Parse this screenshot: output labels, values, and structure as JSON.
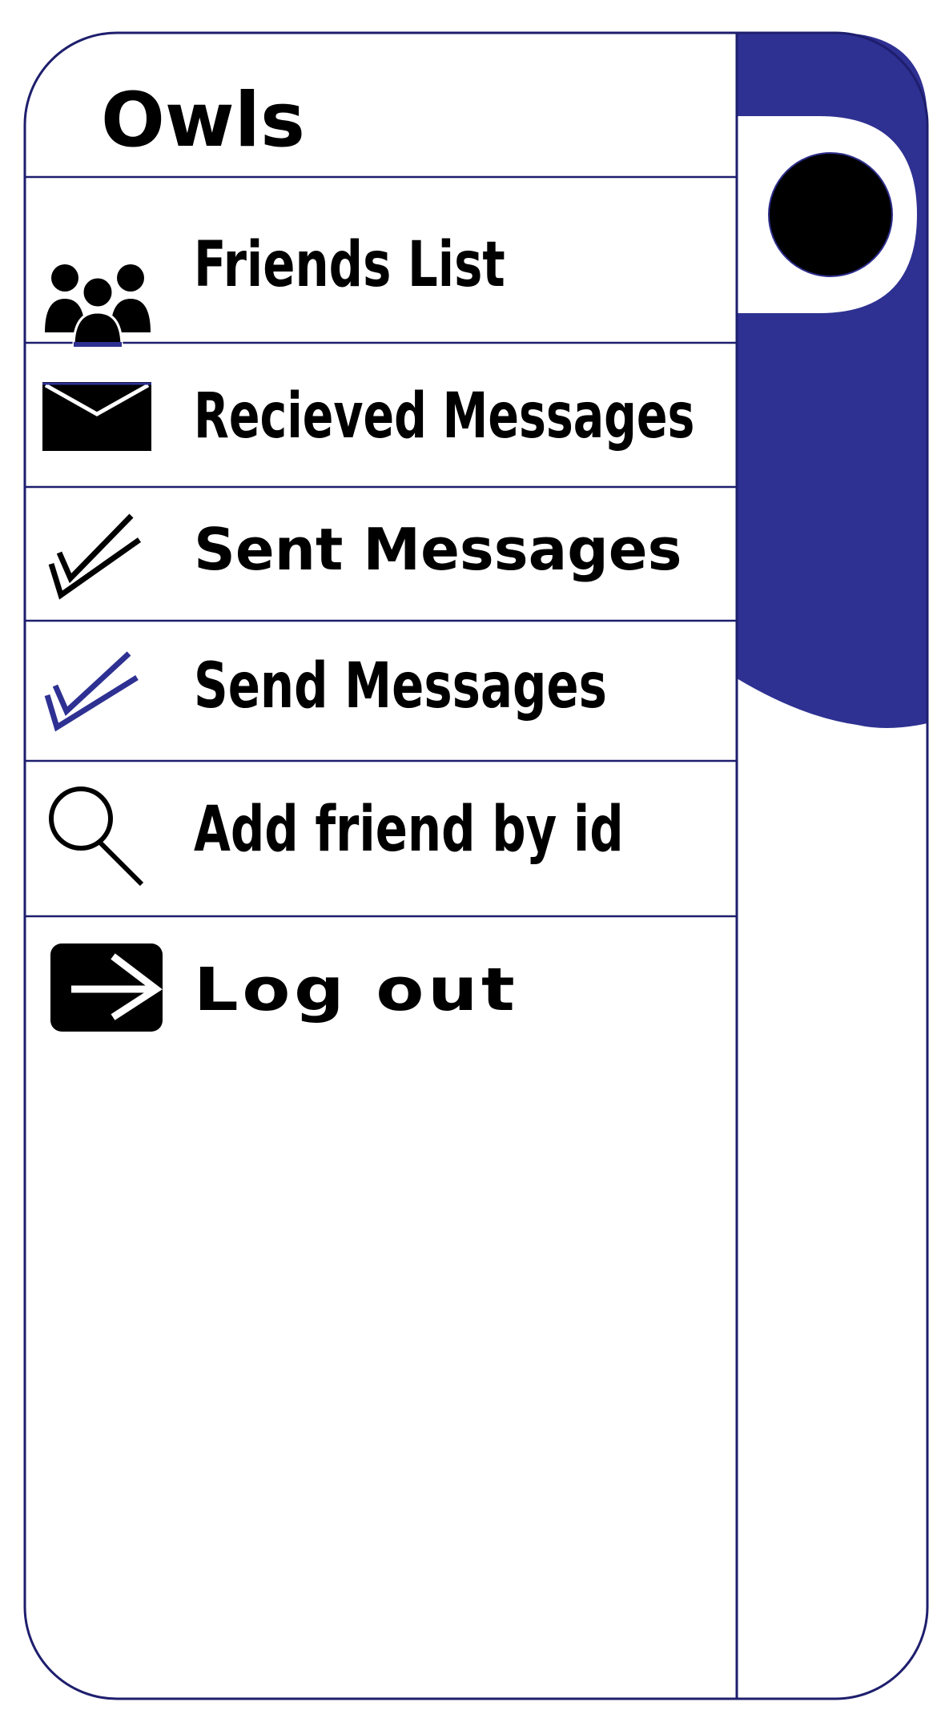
{
  "app": {
    "title": "Owls"
  },
  "menu": {
    "items": [
      {
        "label": "Friends List",
        "icon": "friends-group-icon"
      },
      {
        "label": "Recieved Messages",
        "icon": "envelope-icon"
      },
      {
        "label": "Sent Messages",
        "icon": "double-check-icon"
      },
      {
        "label": "Send Messages",
        "icon": "double-check-accent-icon"
      },
      {
        "label": "Add friend by id",
        "icon": "search-icon"
      },
      {
        "label": "Log out",
        "icon": "logout-arrow-icon"
      }
    ]
  },
  "colors": {
    "accent": "#2e3192",
    "border": "#1e1e6e",
    "icon": "#000000",
    "background": "#ffffff"
  }
}
